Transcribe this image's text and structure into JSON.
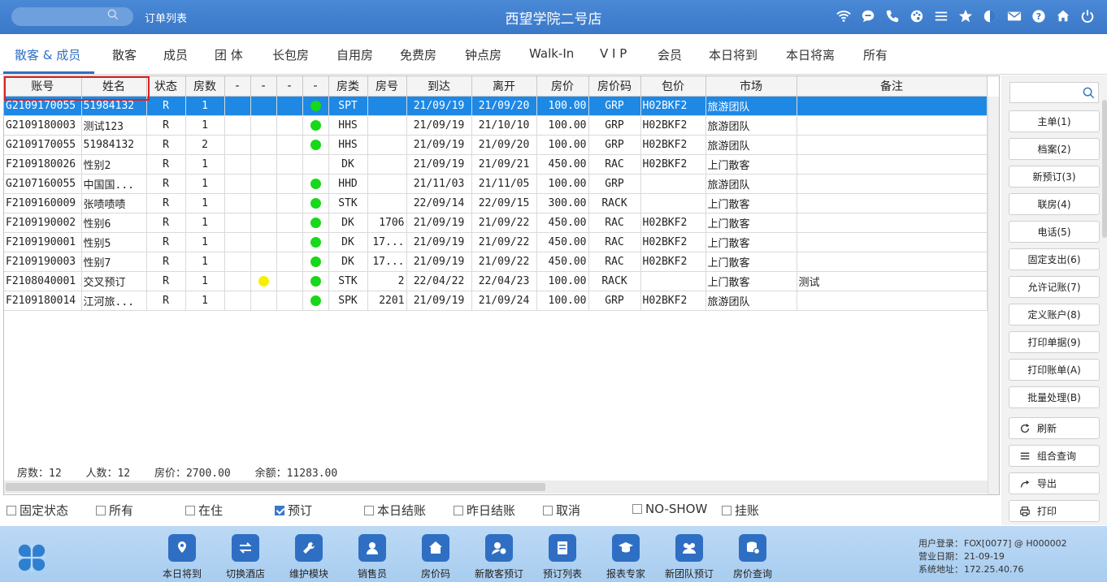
{
  "header": {
    "search_placeholder": "",
    "page_title": "订单列表",
    "hotel_name": "西望学院二号店",
    "icons": [
      "wifi-icon",
      "chat-icon",
      "phone-icon",
      "palette-icon",
      "menu-icon",
      "star-icon",
      "theme-icon",
      "mail-icon",
      "help-icon",
      "home-icon",
      "power-icon"
    ]
  },
  "tabs": [
    "散客 & 成员",
    "散客",
    "成员",
    "团 体",
    "长包房",
    "自用房",
    "免费房",
    "钟点房",
    "Walk-In",
    "V I P",
    "会员",
    "本日将到",
    "本日将离",
    "所有"
  ],
  "table": {
    "columns": [
      "账号",
      "姓名",
      "状态",
      "房数",
      "-",
      "-",
      "-",
      "-",
      "房类",
      "房号",
      "到达",
      "离开",
      "房价",
      "房价码",
      "包价",
      "市场",
      "备注"
    ],
    "rows": [
      {
        "acct": "G2109170055",
        "name": "51984132",
        "status": "R",
        "rooms": "1",
        "d2": "",
        "d4": "green",
        "type": "SPT",
        "room": "",
        "arr": "21/09/19",
        "dep": "21/09/20",
        "rate": "100.00",
        "code": "GRP",
        "pkg": "H02BKF2",
        "market": "旅游团队",
        "note": ""
      },
      {
        "acct": "G2109180003",
        "name": "测试123",
        "status": "R",
        "rooms": "1",
        "d2": "",
        "d4": "green",
        "type": "HHS",
        "room": "",
        "arr": "21/09/19",
        "dep": "21/10/10",
        "rate": "100.00",
        "code": "GRP",
        "pkg": "H02BKF2",
        "market": "旅游团队",
        "note": ""
      },
      {
        "acct": "G2109170055",
        "name": "51984132",
        "status": "R",
        "rooms": "2",
        "d2": "",
        "d4": "green",
        "type": "HHS",
        "room": "",
        "arr": "21/09/19",
        "dep": "21/09/20",
        "rate": "100.00",
        "code": "GRP",
        "pkg": "H02BKF2",
        "market": "旅游团队",
        "note": ""
      },
      {
        "acct": "F2109180026",
        "name": "性别2",
        "status": "R",
        "rooms": "1",
        "d2": "",
        "d4": "",
        "type": "DK",
        "room": "",
        "arr": "21/09/19",
        "dep": "21/09/21",
        "rate": "450.00",
        "code": "RAC",
        "pkg": "H02BKF2",
        "market": "上门散客",
        "note": ""
      },
      {
        "acct": "G2107160055",
        "name": "中国国...",
        "status": "R",
        "rooms": "1",
        "d2": "",
        "d4": "green",
        "type": "HHD",
        "room": "",
        "arr": "21/11/03",
        "dep": "21/11/05",
        "rate": "100.00",
        "code": "GRP",
        "pkg": "",
        "market": "旅游团队",
        "note": ""
      },
      {
        "acct": "F2109160009",
        "name": "张啧啧啧",
        "status": "R",
        "rooms": "1",
        "d2": "",
        "d4": "green",
        "type": "STK",
        "room": "",
        "arr": "22/09/14",
        "dep": "22/09/15",
        "rate": "300.00",
        "code": "RACK",
        "pkg": "",
        "market": "上门散客",
        "note": ""
      },
      {
        "acct": "F2109190002",
        "name": "性别6",
        "status": "R",
        "rooms": "1",
        "d2": "",
        "d4": "green",
        "type": "DK",
        "room": "1706",
        "arr": "21/09/19",
        "dep": "21/09/22",
        "rate": "450.00",
        "code": "RAC",
        "pkg": "H02BKF2",
        "market": "上门散客",
        "note": ""
      },
      {
        "acct": "F2109190001",
        "name": "性别5",
        "status": "R",
        "rooms": "1",
        "d2": "",
        "d4": "green",
        "type": "DK",
        "room": "17...",
        "arr": "21/09/19",
        "dep": "21/09/22",
        "rate": "450.00",
        "code": "RAC",
        "pkg": "H02BKF2",
        "market": "上门散客",
        "note": ""
      },
      {
        "acct": "F2109190003",
        "name": "性别7",
        "status": "R",
        "rooms": "1",
        "d2": "",
        "d4": "green",
        "type": "DK",
        "room": "17...",
        "arr": "21/09/19",
        "dep": "21/09/22",
        "rate": "450.00",
        "code": "RAC",
        "pkg": "H02BKF2",
        "market": "上门散客",
        "note": ""
      },
      {
        "acct": "F2108040001",
        "name": "交叉预订",
        "status": "R",
        "rooms": "1",
        "d2": "yellow",
        "d4": "green",
        "type": "STK",
        "room": "2",
        "arr": "22/04/22",
        "dep": "22/04/23",
        "rate": "100.00",
        "code": "RACK",
        "pkg": "",
        "market": "上门散客",
        "note": "测试"
      },
      {
        "acct": "F2109180014",
        "name": "江河旅...",
        "status": "R",
        "rooms": "1",
        "d2": "",
        "d4": "green",
        "type": "SPK",
        "room": "2201",
        "arr": "21/09/19",
        "dep": "21/09/24",
        "rate": "100.00",
        "code": "GRP",
        "pkg": "H02BKF2",
        "market": "旅游团队",
        "note": ""
      }
    ],
    "selected_row": 0,
    "summary": {
      "rooms": "房数：12",
      "people": "人数：12",
      "rate": "房价：2700.00",
      "balance": "余额：11283.00"
    }
  },
  "filters": [
    {
      "label": "固定状态",
      "checked": false
    },
    {
      "label": "所有",
      "checked": false
    },
    {
      "label": "在住",
      "checked": false
    },
    {
      "label": "预订",
      "checked": true
    },
    {
      "label": "本日结账",
      "checked": false
    },
    {
      "label": "昨日结账",
      "checked": false
    },
    {
      "label": "取消",
      "checked": false
    },
    {
      "label": "NO-SHOW",
      "checked": false
    },
    {
      "label": "挂账",
      "checked": false
    }
  ],
  "side": {
    "buttons": [
      "主单(1)",
      "档案(2)",
      "新预订(3)",
      "联房(4)",
      "电话(5)",
      "固定支出(6)",
      "允许记账(7)",
      "定义账户(8)",
      "打印单据(9)",
      "打印账单(A)",
      "批量处理(B)"
    ],
    "refresh": "刷新",
    "combo_query": "组合查询",
    "export": "导出",
    "print": "打印"
  },
  "bottom": {
    "items": [
      "本日将到",
      "切换酒店",
      "维护模块",
      "销售员",
      "房价码",
      "新散客预订",
      "预订列表",
      "报表专家",
      "新团队预订",
      "房价查询"
    ],
    "info": {
      "user_label": "用户登录：",
      "user": "FOX[0077] @ H000002",
      "date_label": "营业日期：",
      "date": "21-09-19",
      "addr_label": "系统地址：",
      "addr": "172.25.40.76"
    }
  }
}
